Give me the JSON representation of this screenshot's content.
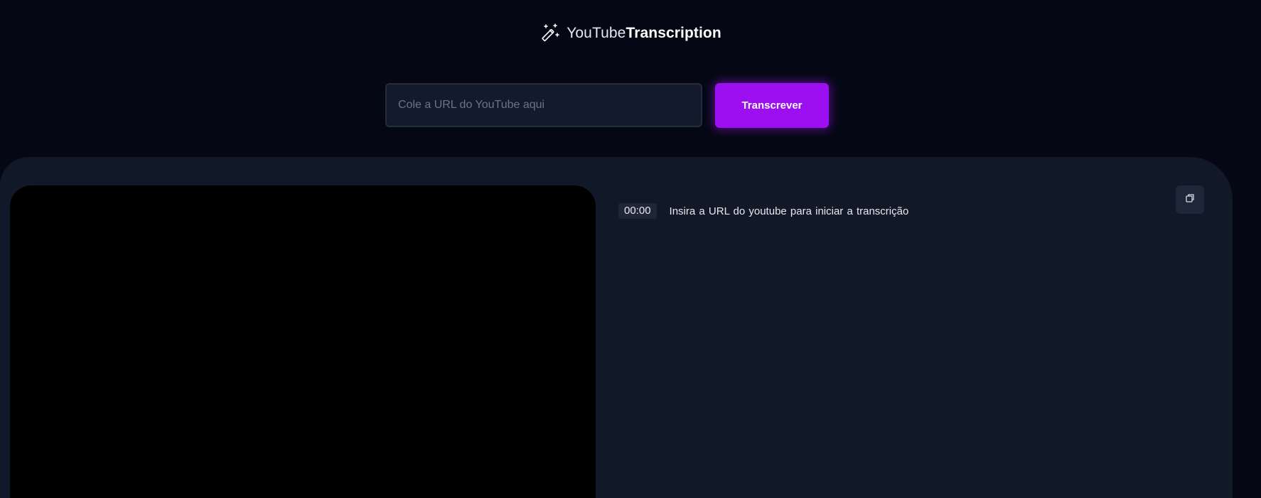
{
  "header": {
    "logo_icon": "magic-wand-sparkles-icon",
    "brand_light": "YouTube",
    "brand_bold": "Transcription"
  },
  "search": {
    "placeholder": "Cole a URL do YouTube aqui",
    "value": "",
    "button_label": "Transcrever"
  },
  "colors": {
    "accent": "#9b0ff0",
    "background": "#050814",
    "panel": "#111828"
  },
  "transcript": {
    "items": [
      {
        "time": "00:00",
        "text": "Insira a URL  do youtube para  iniciar a transcrição"
      }
    ],
    "copy_icon": "copy-icon"
  },
  "player": {
    "state": "empty"
  }
}
